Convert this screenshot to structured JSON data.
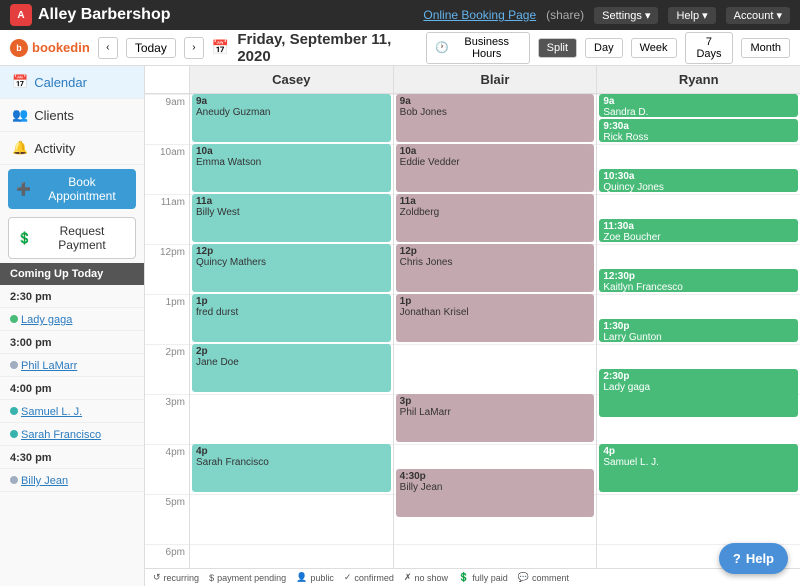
{
  "topNav": {
    "logoText": "Alley Barbershop",
    "onlineBookingLabel": "Online Booking Page",
    "shareLabel": "(share)",
    "settingsLabel": "Settings ▾",
    "helpLabel": "Help ▾",
    "accountLabel": "Account ▾"
  },
  "subNav": {
    "bookedInLabel": "bookedin",
    "todayLabel": "Today",
    "currentDate": "Friday, September 11, 2020",
    "businessHoursLabel": "Business Hours",
    "splitLabel": "Split",
    "dayLabel": "Day",
    "weekLabel": "Week",
    "sevenDayLabel": "7 Days",
    "monthLabel": "Month"
  },
  "sidebar": {
    "calendarLabel": "Calendar",
    "clientsLabel": "Clients",
    "activityLabel": "Activity",
    "bookAppointmentLabel": "Book Appointment",
    "requestPaymentLabel": "Request Payment",
    "comingUpTodayLabel": "Coming Up Today",
    "upcomingItems": [
      {
        "time": "2:30 pm",
        "name": "Lady gaga",
        "dotClass": "dot-green"
      },
      {
        "time": "3:00 pm",
        "name": "Phil LaMarr",
        "dotClass": "dot-gray"
      },
      {
        "time": "4:00 pm",
        "name": "Samuel L. J.",
        "dotClass": "dot-teal"
      },
      {
        "time": "4:00 pm",
        "name": "Sarah Francisco",
        "dotClass": "dot-teal"
      },
      {
        "time": "4:30 pm",
        "name": "Billy Jean",
        "dotClass": "dot-gray"
      }
    ]
  },
  "calendar": {
    "staff": [
      "Casey",
      "Blair",
      "Ryann"
    ],
    "timeSlots": [
      "9am",
      "10am",
      "11am",
      "12pm",
      "1pm",
      "2pm",
      "3pm",
      "4pm",
      "5pm",
      "6pm"
    ],
    "caseyAppointments": [
      {
        "startHour": 9,
        "startMin": 0,
        "endHour": 10,
        "endMin": 0,
        "time": "9a",
        "name": "Aneudy Guzman",
        "color": "teal"
      },
      {
        "startHour": 10,
        "startMin": 0,
        "endHour": 11,
        "endMin": 0,
        "time": "10a",
        "name": "Emma Watson",
        "color": "teal"
      },
      {
        "startHour": 11,
        "startMin": 0,
        "endHour": 12,
        "endMin": 0,
        "time": "11a",
        "name": "Billy West",
        "color": "teal"
      },
      {
        "startHour": 12,
        "startMin": 0,
        "endHour": 13,
        "endMin": 0,
        "time": "12p",
        "name": "Quincy Mathers",
        "color": "teal"
      },
      {
        "startHour": 13,
        "startMin": 0,
        "endHour": 14,
        "endMin": 0,
        "time": "1p",
        "name": "fred durst",
        "color": "teal"
      },
      {
        "startHour": 14,
        "startMin": 0,
        "endHour": 15,
        "endMin": 0,
        "time": "2p",
        "name": "Jane Doe",
        "color": "teal"
      },
      {
        "startHour": 16,
        "startMin": 0,
        "endHour": 17,
        "endMin": 0,
        "time": "4p",
        "name": "Sarah Francisco",
        "color": "teal"
      }
    ],
    "blairAppointments": [
      {
        "startHour": 9,
        "startMin": 0,
        "endHour": 10,
        "endMin": 0,
        "time": "9a",
        "name": "Bob Jones",
        "color": "rose"
      },
      {
        "startHour": 10,
        "startMin": 0,
        "endHour": 11,
        "endMin": 0,
        "time": "10a",
        "name": "Eddie Vedder",
        "color": "rose"
      },
      {
        "startHour": 11,
        "startMin": 0,
        "endHour": 12,
        "endMin": 0,
        "time": "11a",
        "name": "Zoldberg",
        "color": "rose"
      },
      {
        "startHour": 12,
        "startMin": 0,
        "endHour": 13,
        "endMin": 0,
        "time": "12p",
        "name": "Chris Jones",
        "color": "rose"
      },
      {
        "startHour": 13,
        "startMin": 0,
        "endHour": 14,
        "endMin": 0,
        "time": "1p",
        "name": "Jonathan Krisel",
        "color": "rose"
      },
      {
        "startHour": 15,
        "startMin": 0,
        "endHour": 16,
        "endMin": 0,
        "time": "3p",
        "name": "Phil LaMarr",
        "color": "rose"
      },
      {
        "startHour": 16,
        "startMin": 30,
        "endHour": 17,
        "endMin": 30,
        "time": "4:30p",
        "name": "Billy Jean",
        "color": "rose"
      }
    ],
    "ryannAppointments": [
      {
        "startHour": 9,
        "startMin": 0,
        "endHour": 9,
        "endMin": 30,
        "time": "9a",
        "name": "Sandra D.",
        "color": "green"
      },
      {
        "startHour": 9,
        "startMin": 30,
        "endHour": 10,
        "endMin": 0,
        "time": "9:30a",
        "name": "Rick Ross",
        "color": "green"
      },
      {
        "startHour": 10,
        "startMin": 30,
        "endHour": 11,
        "endMin": 0,
        "time": "10:30a",
        "name": "Quincy Jones",
        "color": "green"
      },
      {
        "startHour": 11,
        "startMin": 30,
        "endHour": 12,
        "endMin": 0,
        "time": "11:30a",
        "name": "Zoe Boucher",
        "color": "green"
      },
      {
        "startHour": 12,
        "startMin": 30,
        "endHour": 13,
        "endMin": 0,
        "time": "12:30p",
        "name": "Kaitlyn Francesco",
        "color": "green"
      },
      {
        "startHour": 13,
        "startMin": 30,
        "endHour": 14,
        "endMin": 0,
        "time": "1:30p",
        "name": "Larry Gunton",
        "color": "green"
      },
      {
        "startHour": 14,
        "startMin": 30,
        "endHour": 15,
        "endMin": 30,
        "time": "2:30p",
        "name": "Lady gaga",
        "color": "green"
      },
      {
        "startHour": 16,
        "startMin": 0,
        "endHour": 17,
        "endMin": 0,
        "time": "4p",
        "name": "Samuel L. J.",
        "color": "green"
      }
    ]
  },
  "legend": {
    "items": [
      {
        "icon": "↺",
        "label": "recurring"
      },
      {
        "icon": "$",
        "label": "payment pending"
      },
      {
        "icon": "👤",
        "label": "public"
      },
      {
        "icon": "✓",
        "label": "confirmed"
      },
      {
        "icon": "✗",
        "label": "no show"
      },
      {
        "icon": "💲",
        "label": "fully paid"
      },
      {
        "icon": "💬",
        "label": "comment"
      }
    ]
  },
  "helpButton": {
    "label": "Help"
  }
}
